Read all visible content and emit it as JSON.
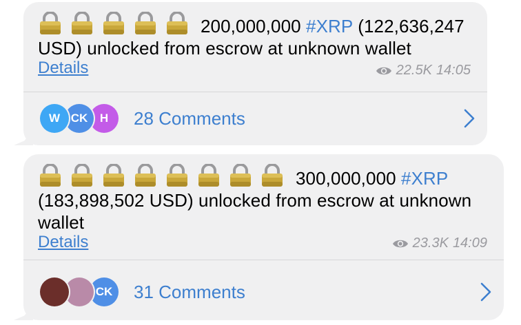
{
  "messages": [
    {
      "lock_count": 5,
      "amount": "200,000,000",
      "hashtag": "#XRP",
      "text_after": "(122,636,247 USD) unlocked from escrow at unknown wallet",
      "details_link": "Details",
      "views": "22.5K",
      "time": "14:05",
      "comments_label": "28 Comments",
      "avatars": [
        {
          "initials": "W",
          "color": "#3ea7f5"
        },
        {
          "initials": "CK",
          "color": "#4f8fe6"
        },
        {
          "initials": "H",
          "color": "#c35be8"
        }
      ]
    },
    {
      "lock_count": 8,
      "amount": "300,000,000",
      "hashtag": "#XRP",
      "text_after": "(183,898,502 USD) unlocked from escrow at unknown wallet",
      "details_link": "Details",
      "views": "23.3K",
      "time": "14:09",
      "comments_label": "31 Comments",
      "avatars": [
        {
          "initials": "",
          "color": "#6b2e2a"
        },
        {
          "initials": "",
          "color": "#b98aa8"
        },
        {
          "initials": "CK",
          "color": "#4f8fe6"
        }
      ]
    }
  ],
  "colors": {
    "bubble": "#f0f0f1",
    "link": "#3d7fcf",
    "meta": "#9a9a9f"
  }
}
